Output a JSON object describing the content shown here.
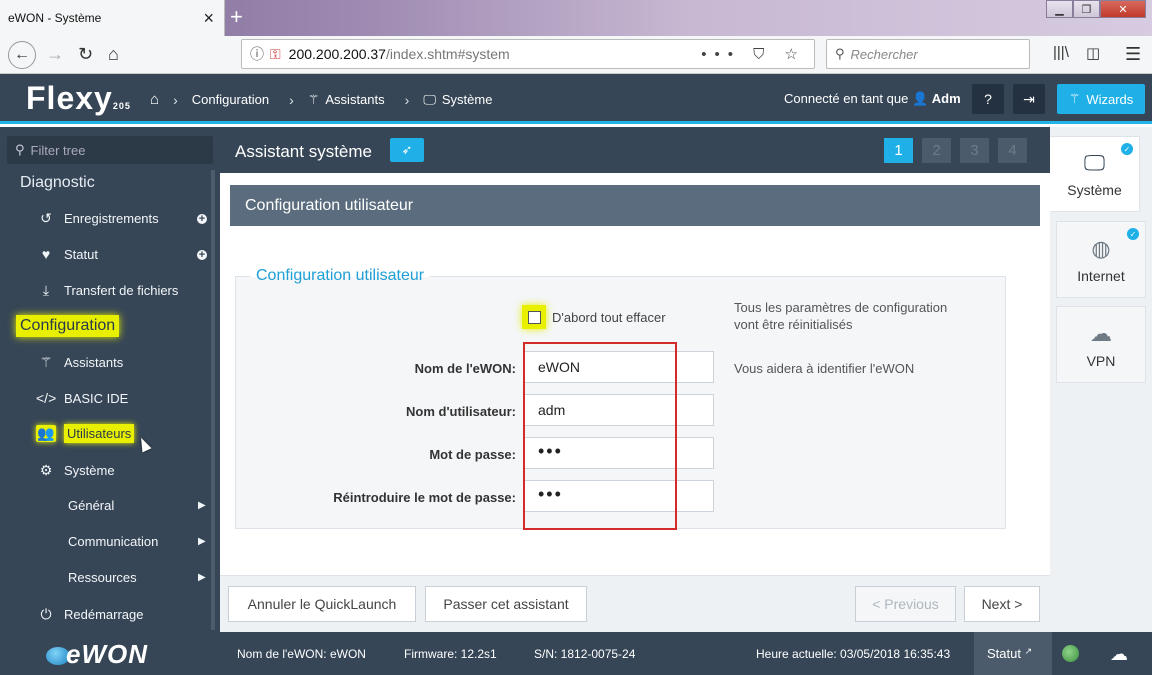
{
  "browser": {
    "tab_title": "eWON - Système",
    "url_host": "200.200.200.37",
    "url_path": "/index.shtm#system",
    "search_placeholder": "Rechercher"
  },
  "header": {
    "logo": "Flexy",
    "logo_sub": "205",
    "breadcrumb": [
      "Configuration",
      "Assistants",
      "Système"
    ],
    "user_prefix": "Connecté en tant que",
    "user_name": "Adm",
    "wizards_label": "Wizards"
  },
  "sidebar": {
    "filter_placeholder": "Filter tree",
    "diagnostic_label": "Diagnostic",
    "diagnostic_items": [
      "Enregistrements",
      "Statut",
      "Transfert de fichiers"
    ],
    "configuration_label": "Configuration",
    "configuration_items": [
      "Assistants",
      "BASIC IDE",
      "Utilisateurs",
      "Système"
    ],
    "system_sub": [
      "Général",
      "Communication",
      "Ressources"
    ],
    "restart_label": "Redémarrage",
    "brand": "eWON"
  },
  "main": {
    "title": "Assistant système",
    "steps": [
      "1",
      "2",
      "3",
      "4"
    ],
    "active_step": 1,
    "section_title": "Configuration utilisateur",
    "fieldset_legend": "Configuration utilisateur",
    "checkbox_label": "D'abord tout effacer",
    "checkbox_help_line1": "Tous les paramètres de configuration",
    "checkbox_help_line2": "vont être réinitialisés",
    "fields": [
      {
        "label": "Nom de l'eWON:",
        "value": "eWON",
        "help": "Vous aidera à identifier l'eWON"
      },
      {
        "label": "Nom d'utilisateur:",
        "value": "adm",
        "help": ""
      },
      {
        "label": "Mot de passe:",
        "value": "•••",
        "help": ""
      },
      {
        "label": "Réintroduire le mot de passe:",
        "value": "•••",
        "help": ""
      }
    ],
    "buttons": {
      "cancel": "Annuler le QuickLaunch",
      "skip": "Passer cet assistant",
      "previous": "< Previous",
      "next": "Next >"
    }
  },
  "right_tabs": [
    "Système",
    "Internet",
    "VPN"
  ],
  "statusbar": {
    "name": "Nom de l'eWON: eWON",
    "firmware": "Firmware: 12.2s1",
    "serial": "S/N: 1812-0075-24",
    "time": "Heure actuelle: 03/05/2018 16:35:43",
    "statut": "Statut"
  },
  "colors": {
    "header_bg": "#364656",
    "accent": "#1eb0e6",
    "highlight": "#e8f000",
    "annotation_red": "#d42a2a"
  }
}
